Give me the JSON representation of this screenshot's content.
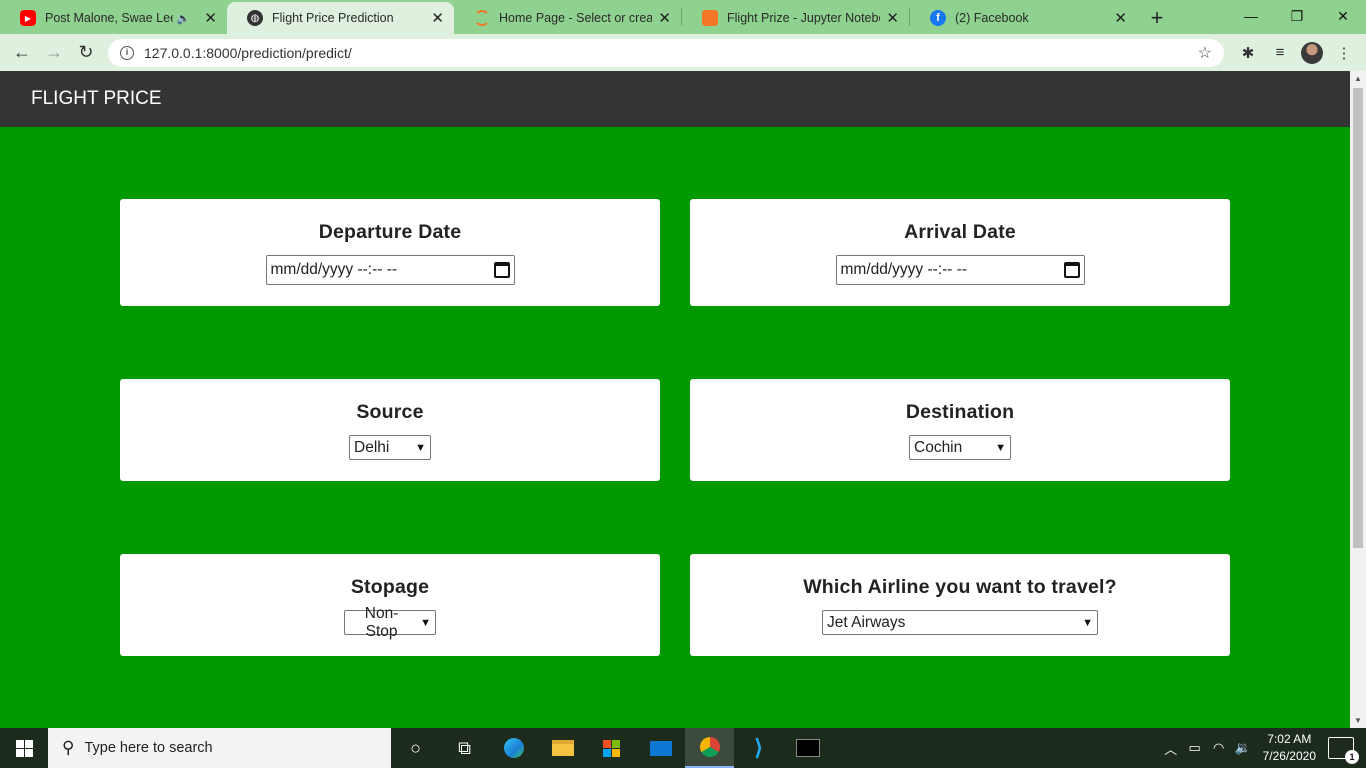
{
  "browser": {
    "tabs": [
      {
        "title": "Post Malone, Swae Lee - S",
        "icon": "youtube-icon",
        "active": false,
        "has_mute": true
      },
      {
        "title": "Flight Price Prediction",
        "icon": "globe-icon",
        "active": true,
        "has_mute": false
      },
      {
        "title": "Home Page - Select or create a",
        "icon": "jupyter-icon",
        "active": false,
        "has_mute": false
      },
      {
        "title": "Flight Prize - Jupyter Notebook",
        "icon": "notebook-icon",
        "active": false,
        "has_mute": false
      },
      {
        "title": "(2) Facebook",
        "icon": "facebook-icon",
        "active": false,
        "has_mute": false
      }
    ],
    "url": "127.0.0.1:8000/prediction/predict/"
  },
  "page": {
    "brand": "FLIGHT PRICE",
    "departure": {
      "label": "Departure Date",
      "placeholder": "mm/dd/yyyy --:-- --"
    },
    "arrival": {
      "label": "Arrival Date",
      "placeholder": "mm/dd/yyyy --:-- --"
    },
    "source": {
      "label": "Source",
      "value": "Delhi"
    },
    "destination": {
      "label": "Destination",
      "value": "Cochin"
    },
    "stopage": {
      "label": "Stopage",
      "value": "Non-Stop"
    },
    "airline": {
      "label": "Which Airline you want to travel?",
      "value": "Jet Airways"
    },
    "colors": {
      "page_bg": "#009a00",
      "navbar_bg": "#343434",
      "card_bg": "#ffffff"
    }
  },
  "taskbar": {
    "search_placeholder": "Type here to search",
    "time": "7:02 AM",
    "date": "7/26/2020",
    "notification_count": "1"
  }
}
